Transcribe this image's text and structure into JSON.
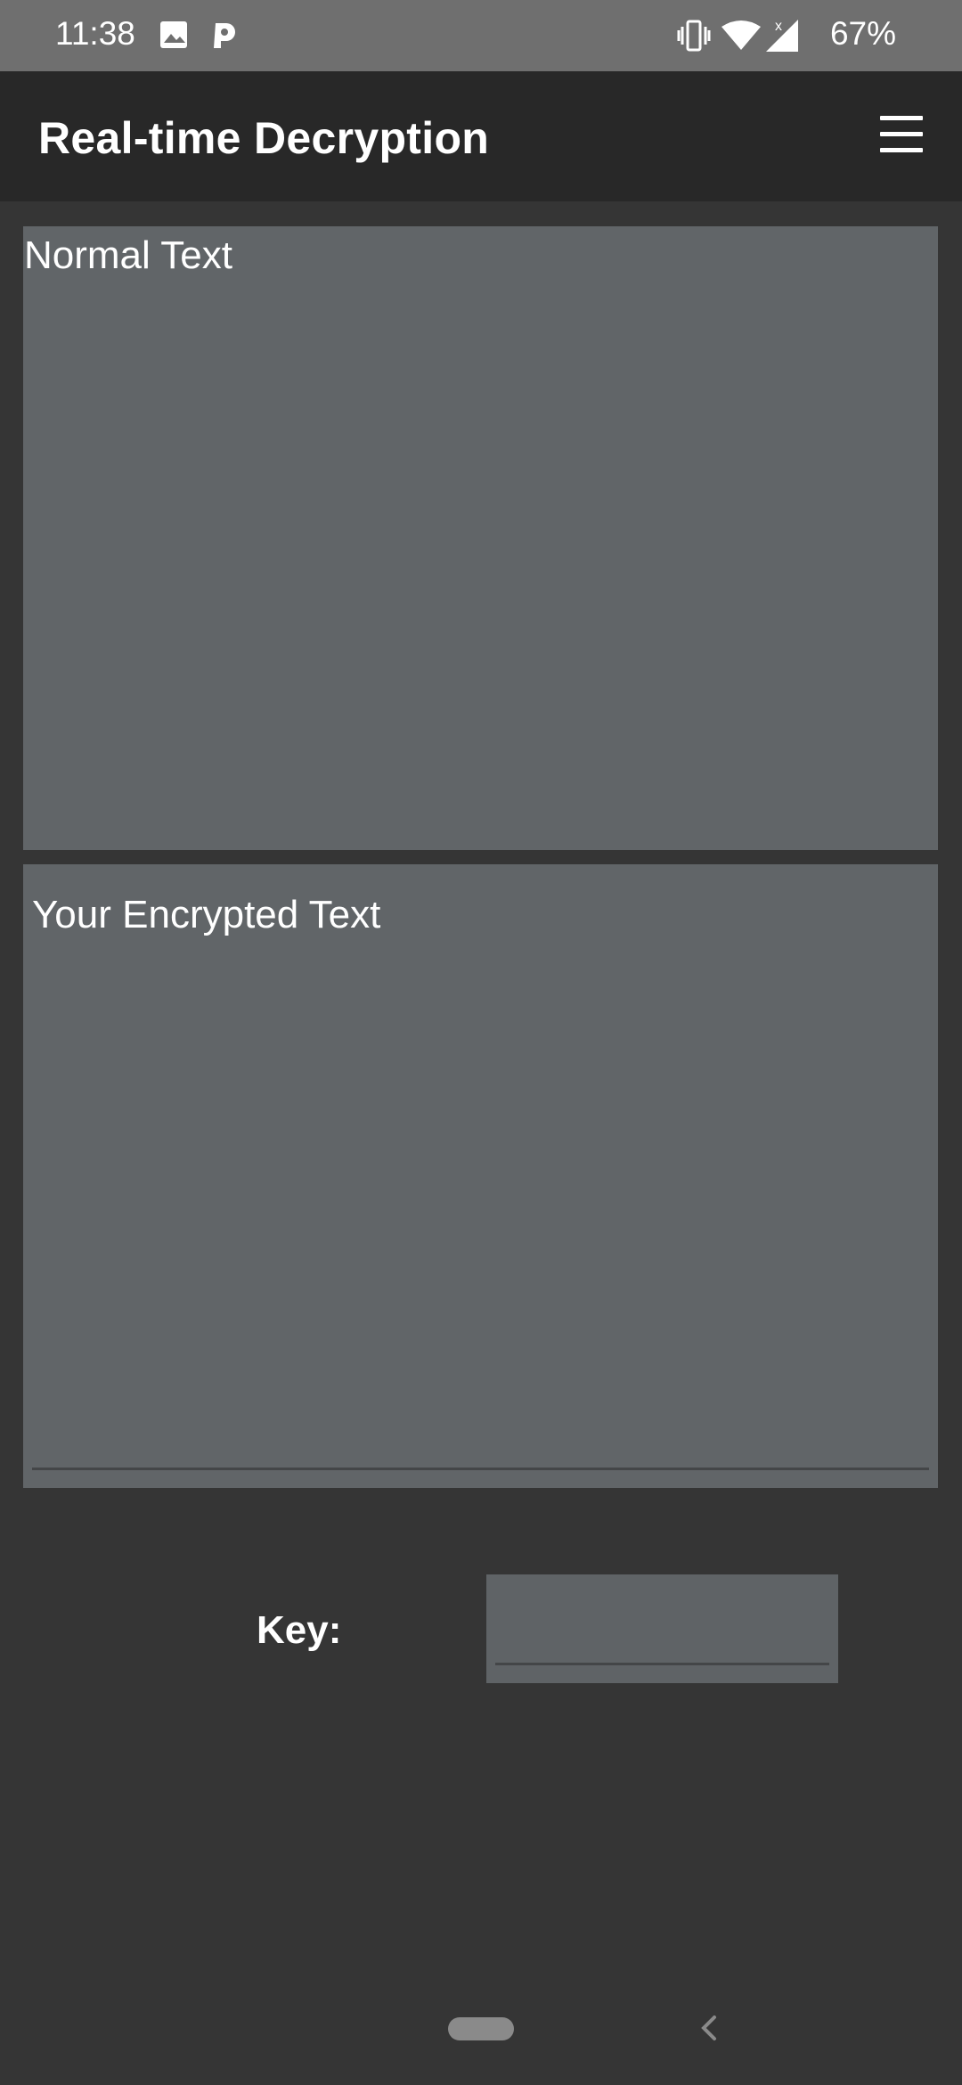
{
  "status_bar": {
    "time": "11:38",
    "battery": "67%",
    "icons": [
      "image-icon",
      "parking-icon",
      "vibrate-icon",
      "wifi-icon",
      "signal-icon"
    ]
  },
  "app_bar": {
    "title": "Real-time Decryption",
    "menu_icon": "hamburger-menu-icon"
  },
  "main": {
    "normal_text_placeholder": "Normal Text",
    "encrypted_text_placeholder": "Your Encrypted Text",
    "key_label": "Key:",
    "key_value": ""
  },
  "colors": {
    "status_bar": "#6f6f6f",
    "app_bar": "#282828",
    "background": "#353535",
    "field": "#616568"
  }
}
